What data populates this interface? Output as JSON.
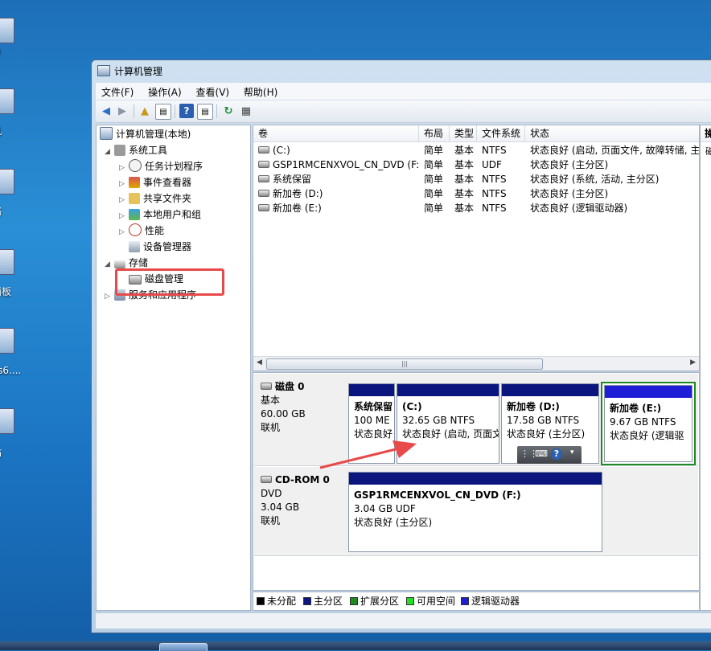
{
  "desktop": {
    "icon_labels": [
      "in",
      "机",
      "络",
      "面板",
      "vs6....",
      "站"
    ]
  },
  "window": {
    "title": "计算机管理"
  },
  "menu": [
    "文件(F)",
    "操作(A)",
    "查看(V)",
    "帮助(H)"
  ],
  "tree": {
    "root": "计算机管理(本地)",
    "system_tools": "系统工具",
    "task_scheduler": "任务计划程序",
    "event_viewer": "事件查看器",
    "shared_folders": "共享文件夹",
    "local_users": "本地用户和组",
    "performance": "性能",
    "device_manager": "设备管理器",
    "storage": "存储",
    "disk_management": "磁盘管理",
    "services_apps": "服务和应用程序"
  },
  "volume_list": {
    "columns": [
      "卷",
      "布局",
      "类型",
      "文件系统",
      "状态"
    ],
    "rows": [
      {
        "name": "(C:)",
        "layout": "简单",
        "type": "基本",
        "fs": "NTFS",
        "status": "状态良好 (启动, 页面文件, 故障转储, 主"
      },
      {
        "name": "GSP1RMCENXVOL_CN_DVD (F:)",
        "layout": "简单",
        "type": "基本",
        "fs": "UDF",
        "status": "状态良好 (主分区)"
      },
      {
        "name": "系统保留",
        "layout": "简单",
        "type": "基本",
        "fs": "NTFS",
        "status": "状态良好 (系统, 活动, 主分区)"
      },
      {
        "name": "新加卷 (D:)",
        "layout": "简单",
        "type": "基本",
        "fs": "NTFS",
        "status": "状态良好 (主分区)"
      },
      {
        "name": "新加卷 (E:)",
        "layout": "简单",
        "type": "基本",
        "fs": "NTFS",
        "status": "状态良好 (逻辑驱动器)"
      }
    ]
  },
  "actions": {
    "header": "操",
    "sub": "磁"
  },
  "disks": [
    {
      "name": "磁盘 0",
      "kind": "基本",
      "size": "60.00 GB",
      "state": "联机",
      "partitions": [
        {
          "name": "系统保留",
          "detail": "100 ME",
          "status": "状态良好"
        },
        {
          "name": "(C:)",
          "detail": "32.65 GB NTFS",
          "status": "状态良好 (启动, 页面文"
        },
        {
          "name": "新加卷  (D:)",
          "detail": "17.58 GB NTFS",
          "status": "状态良好 (主分区)"
        },
        {
          "name": "新加卷  (E:)",
          "detail": "9.67 GB NTFS",
          "status": "状态良好 (逻辑驱"
        }
      ]
    },
    {
      "name": "CD-ROM 0",
      "kind": "DVD",
      "size": "3.04 GB",
      "state": "联机",
      "partitions": [
        {
          "name": "GSP1RMCENXVOL_CN_DVD  (F:)",
          "detail": "3.04 GB UDF",
          "status": "状态良好 (主分区)"
        }
      ]
    }
  ],
  "legend": [
    {
      "label": "未分配",
      "color": "#000000"
    },
    {
      "label": "主分区",
      "color": "#0a167e"
    },
    {
      "label": "扩展分区",
      "color": "#1f8a1f"
    },
    {
      "label": "可用空间",
      "color": "#22e022"
    },
    {
      "label": "逻辑驱动器",
      "color": "#1e1ed6"
    }
  ],
  "colors": {
    "primary_partition": "#0a167e",
    "logical_partition": "#1e1ed6",
    "highlight": "#e84a4a"
  }
}
